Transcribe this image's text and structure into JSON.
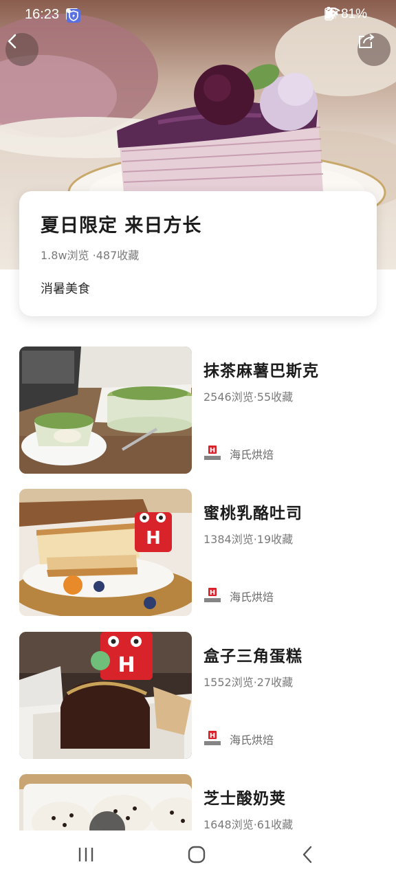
{
  "status_bar": {
    "time": "16:23",
    "battery": "81%",
    "left_icons": [
      "gallery-icon",
      "cloud-icon",
      "shield-icon",
      "dot-icon"
    ],
    "right_icons": [
      "mute-icon",
      "wifi-icon",
      "signal-icon",
      "battery-icon"
    ]
  },
  "hero": {
    "back_icon": "chevron-left-icon",
    "share_icon": "share-icon"
  },
  "collection": {
    "title": "夏日限定 来日方长",
    "stats": "1.8w浏览 ·487收藏",
    "tag": "消暑美食"
  },
  "recipes": [
    {
      "title": "抹茶麻薯巴斯克",
      "stats": "2546浏览·55收藏",
      "brand": "海氏烘焙"
    },
    {
      "title": "蜜桃乳酪吐司",
      "stats": "1384浏览·19收藏",
      "brand": "海氏烘焙"
    },
    {
      "title": "盒子三角蛋糕",
      "stats": "1552浏览·27收藏",
      "brand": "海氏烘焙"
    },
    {
      "title": "芝士酸奶荚",
      "stats": "1648浏览·61收藏",
      "brand": ""
    }
  ],
  "brand_logo": {
    "letter": "H",
    "caption": "海氏烘焙",
    "color": "#d8232a"
  },
  "colors": {
    "accent_red": "#d8232a",
    "title_text": "#1c1c1c",
    "muted_text": "#7a7a7a"
  },
  "nav_bar": {
    "icons": [
      "recent-apps-icon",
      "home-icon",
      "back-icon"
    ]
  }
}
